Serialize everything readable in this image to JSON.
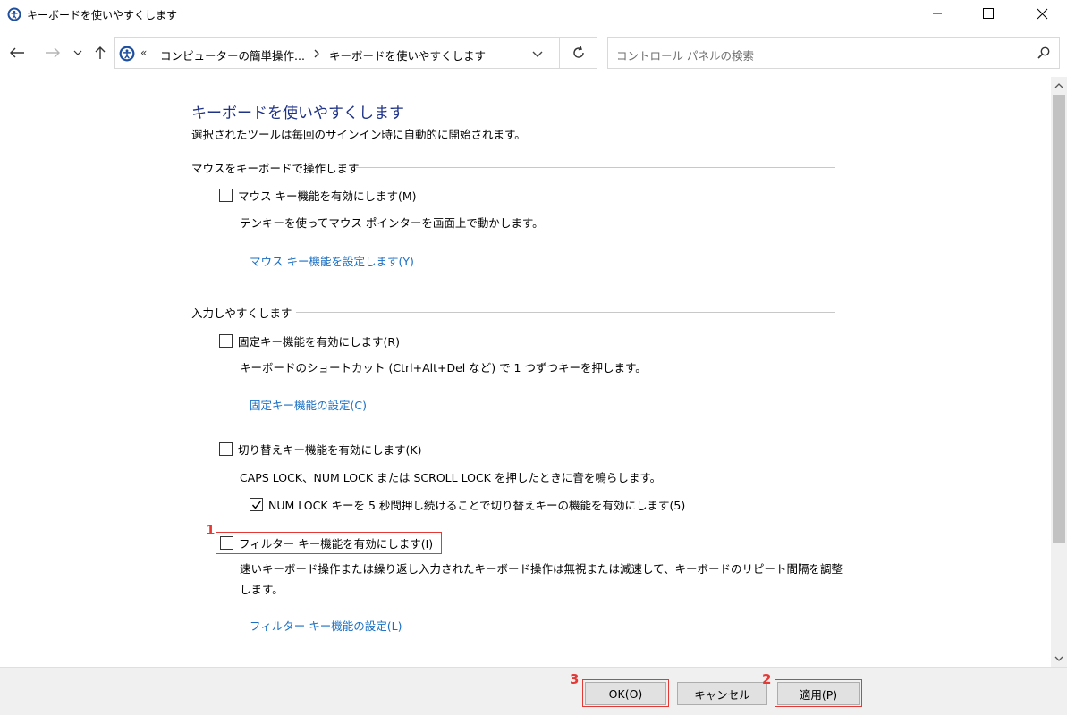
{
  "window": {
    "title": "キーボードを使いやすくします"
  },
  "nav": {
    "breadcrumb_prefix": "«",
    "breadcrumb_1": "コンピューターの簡単操作...",
    "breadcrumb_2": "キーボードを使いやすくします",
    "search_placeholder": "コントロール パネルの検索"
  },
  "page": {
    "title": "キーボードを使いやすくします",
    "subtitle": "選択されたツールは毎回のサインイン時に自動的に開始されます。"
  },
  "mouse_section": {
    "heading": "マウスをキーボードで操作します",
    "checkbox_label": "マウス キー機能を有効にします(M)",
    "checked": false,
    "description": "テンキーを使ってマウス ポインターを画面上で動かします。",
    "link": "マウス キー機能を設定します(Y)"
  },
  "input_section": {
    "heading": "入力しやすくします",
    "sticky": {
      "checkbox_label": "固定キー機能を有効にします(R)",
      "checked": false,
      "description": "キーボードのショートカット (Ctrl+Alt+Del など) で 1 つずつキーを押します。",
      "link": "固定キー機能の設定(C)"
    },
    "toggle": {
      "checkbox_label": "切り替えキー機能を有効にします(K)",
      "checked": false,
      "description": "CAPS LOCK、NUM LOCK または SCROLL LOCK を押したときに音を鳴らします。",
      "sub_checkbox_label": "NUM LOCK キーを 5 秒間押し続けることで切り替えキーの機能を有効にします(5)",
      "sub_checked": true
    },
    "filter": {
      "checkbox_label": "フィルター キー機能を有効にします(I)",
      "checked": false,
      "description_line1": "速いキーボード操作または繰り返し入力されたキーボード操作は無視または減速して、キーボードのリピート間隔を調整",
      "description_line2": "します。",
      "link": "フィルター キー機能の設定(L)"
    }
  },
  "annotations": {
    "marker_1": "1",
    "marker_2": "2",
    "marker_3": "3",
    "color": "#e53935"
  },
  "footer": {
    "ok_label": "OK(O)",
    "cancel_label": "キャンセル",
    "apply_label": "適用(P)"
  },
  "colors": {
    "title_blue": "#1e3287",
    "link_blue": "#1a6fc4"
  }
}
